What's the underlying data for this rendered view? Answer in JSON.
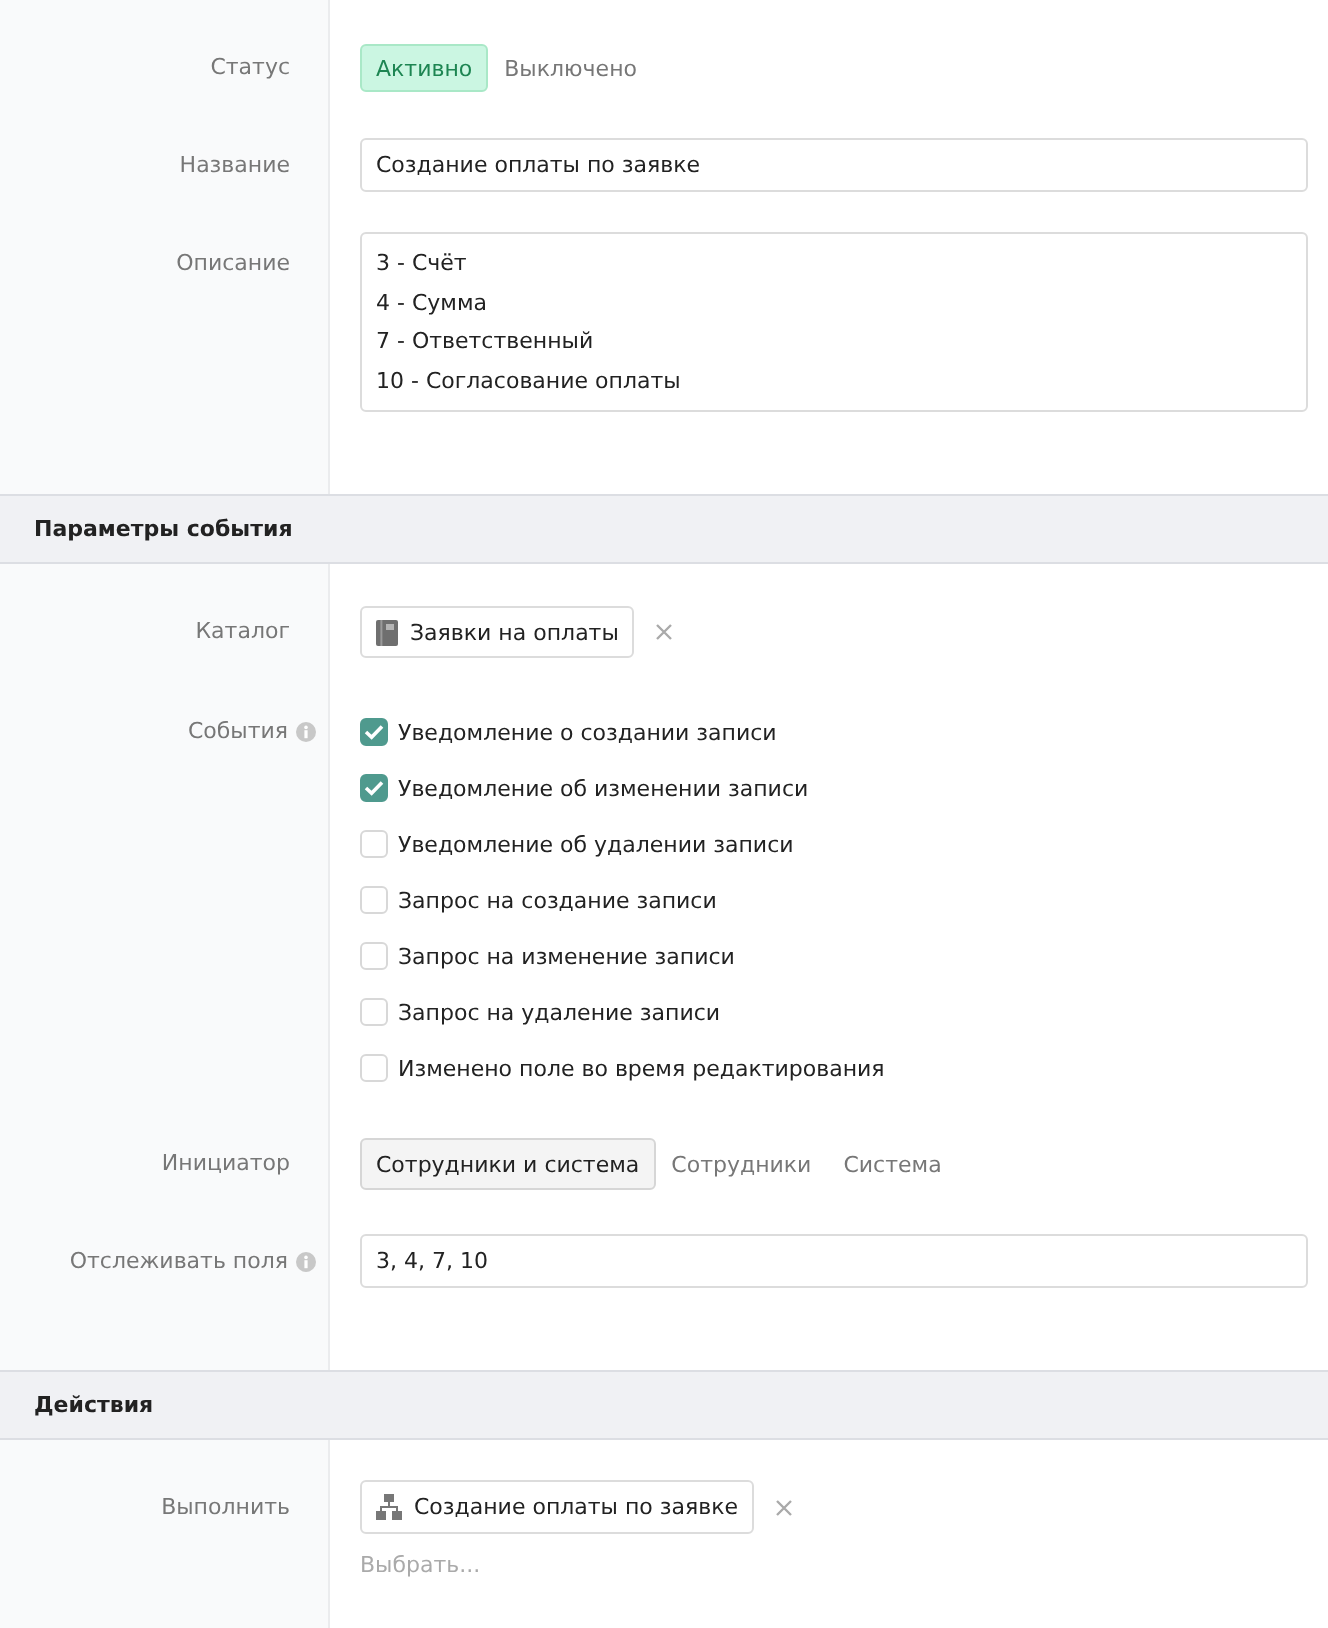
{
  "general": {
    "status": {
      "label": "Статус",
      "options": [
        {
          "label": "Активно",
          "selected": true
        },
        {
          "label": "Выключено",
          "selected": false
        }
      ]
    },
    "name": {
      "label": "Название",
      "value": "Создание оплаты по заявке"
    },
    "description": {
      "label": "Описание",
      "value": "3 - Счёт\n4 - Сумма\n7 - Ответственный\n10 - Согласование оплаты"
    }
  },
  "event_parameters": {
    "title": "Параметры события",
    "catalog": {
      "label": "Каталог",
      "value": "Заявки на оплаты"
    },
    "events": {
      "label": "События",
      "help": true,
      "items": [
        {
          "label": "Уведомление о создании записи",
          "checked": true
        },
        {
          "label": "Уведомление об изменении записи",
          "checked": true
        },
        {
          "label": "Уведомление об удалении записи",
          "checked": false
        },
        {
          "label": "Запрос на создание записи",
          "checked": false
        },
        {
          "label": "Запрос на изменение записи",
          "checked": false
        },
        {
          "label": "Запрос на удаление записи",
          "checked": false
        },
        {
          "label": "Изменено поле во время редактирования",
          "checked": false
        }
      ]
    },
    "initiator": {
      "label": "Инициатор",
      "options": [
        {
          "label": "Сотрудники и система",
          "selected": true
        },
        {
          "label": "Сотрудники",
          "selected": false
        },
        {
          "label": "Система",
          "selected": false
        }
      ]
    },
    "tracked_fields": {
      "label": "Отслеживать поля",
      "help": true,
      "value": "3, 4, 7, 10"
    }
  },
  "actions": {
    "title": "Действия",
    "execute": {
      "label": "Выполнить",
      "value": "Создание оплаты по заявке",
      "placeholder": "Выбрать..."
    }
  }
}
